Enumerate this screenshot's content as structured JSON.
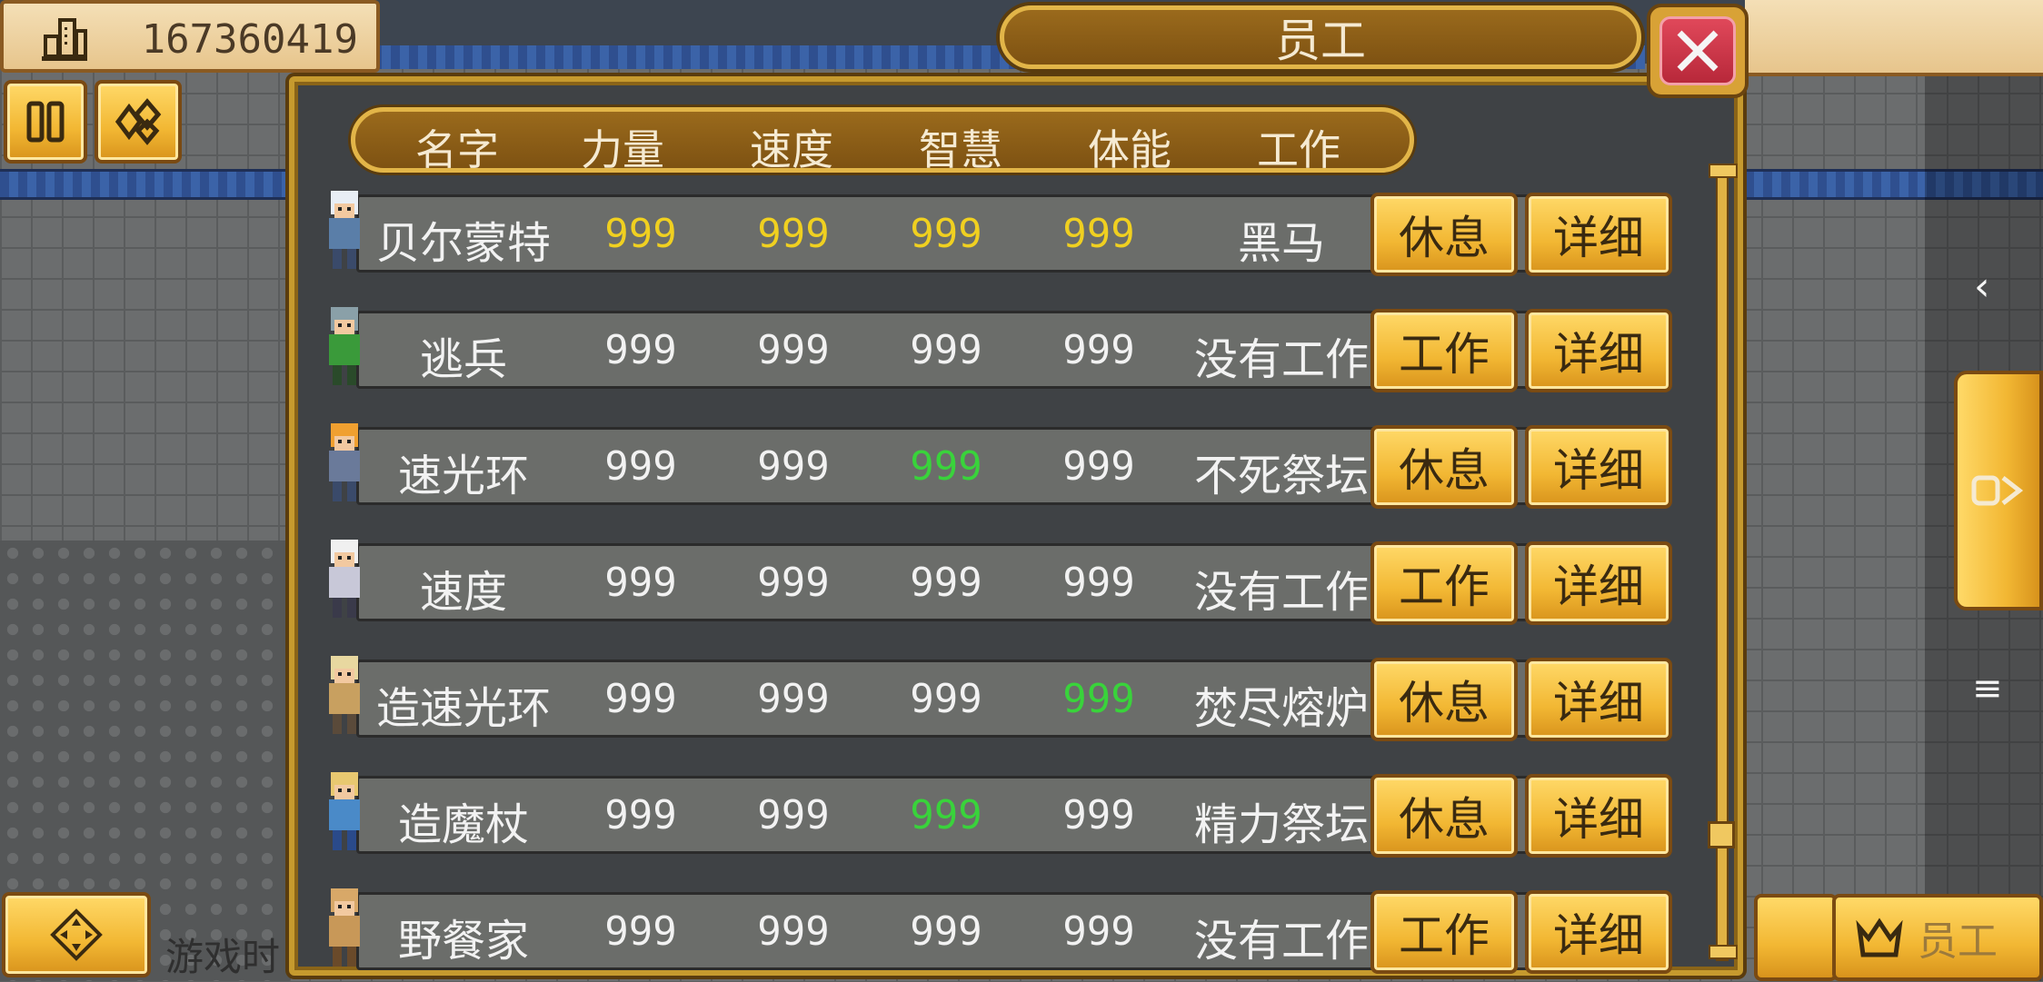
{
  "money": {
    "value": "167360419",
    "icon": "building-icon"
  },
  "dialog": {
    "title": "员工",
    "close_icon": "close-icon"
  },
  "columns": {
    "name": "名字",
    "strength": "力量",
    "speed": "速度",
    "wisdom": "智慧",
    "stamina": "体能",
    "job": "工作"
  },
  "colors": {
    "gold_stat": "#f0d020",
    "green_stat": "#39d33b",
    "white_stat": "#f2f2f2"
  },
  "employees": [
    {
      "name": "贝尔蒙特",
      "strength": "999",
      "speed": "999",
      "wisdom": "999",
      "stamina": "999",
      "job": "黑马",
      "action": "休息",
      "detail": "详细",
      "colors": [
        "#f0d020",
        "#f0d020",
        "#f0d020",
        "#f0d020"
      ]
    },
    {
      "name": "逃兵",
      "strength": "999",
      "speed": "999",
      "wisdom": "999",
      "stamina": "999",
      "job": "没有工作",
      "action": "工作",
      "detail": "详细",
      "colors": [
        "#f2f2f2",
        "#f2f2f2",
        "#f2f2f2",
        "#f2f2f2"
      ]
    },
    {
      "name": "速光环",
      "strength": "999",
      "speed": "999",
      "wisdom": "999",
      "stamina": "999",
      "job": "不死祭坛",
      "action": "休息",
      "detail": "详细",
      "colors": [
        "#f2f2f2",
        "#f2f2f2",
        "#39d33b",
        "#f2f2f2"
      ]
    },
    {
      "name": "速度",
      "strength": "999",
      "speed": "999",
      "wisdom": "999",
      "stamina": "999",
      "job": "没有工作",
      "action": "工作",
      "detail": "详细",
      "colors": [
        "#f2f2f2",
        "#f2f2f2",
        "#f2f2f2",
        "#f2f2f2"
      ]
    },
    {
      "name": "造速光环",
      "strength": "999",
      "speed": "999",
      "wisdom": "999",
      "stamina": "999",
      "job": "焚尽熔炉",
      "action": "休息",
      "detail": "详细",
      "colors": [
        "#f2f2f2",
        "#f2f2f2",
        "#f2f2f2",
        "#39d33b"
      ]
    },
    {
      "name": "造魔杖",
      "strength": "999",
      "speed": "999",
      "wisdom": "999",
      "stamina": "999",
      "job": "精力祭坛",
      "action": "休息",
      "detail": "详细",
      "colors": [
        "#f2f2f2",
        "#f2f2f2",
        "#39d33b",
        "#f2f2f2"
      ]
    },
    {
      "name": "野餐家",
      "strength": "999",
      "speed": "999",
      "wisdom": "999",
      "stamina": "999",
      "job": "没有工作",
      "action": "工作",
      "detail": "详细",
      "colors": [
        "#f2f2f2",
        "#f2f2f2",
        "#f2f2f2",
        "#f2f2f2"
      ]
    }
  ],
  "toolbar": {
    "pause_icon": "pause-icon",
    "shapes_icon": "shapes-icon",
    "dpad_icon": "dpad-icon"
  },
  "bottom": {
    "staff_label": "员工",
    "staff_icon": "crown-icon",
    "game_time_label": "游戏时"
  },
  "system_nav": {
    "back_icon": "chevron-left-icon",
    "menu_icon": "menu-icon",
    "side_tab_icon": "side-tab-arrow-icon"
  }
}
